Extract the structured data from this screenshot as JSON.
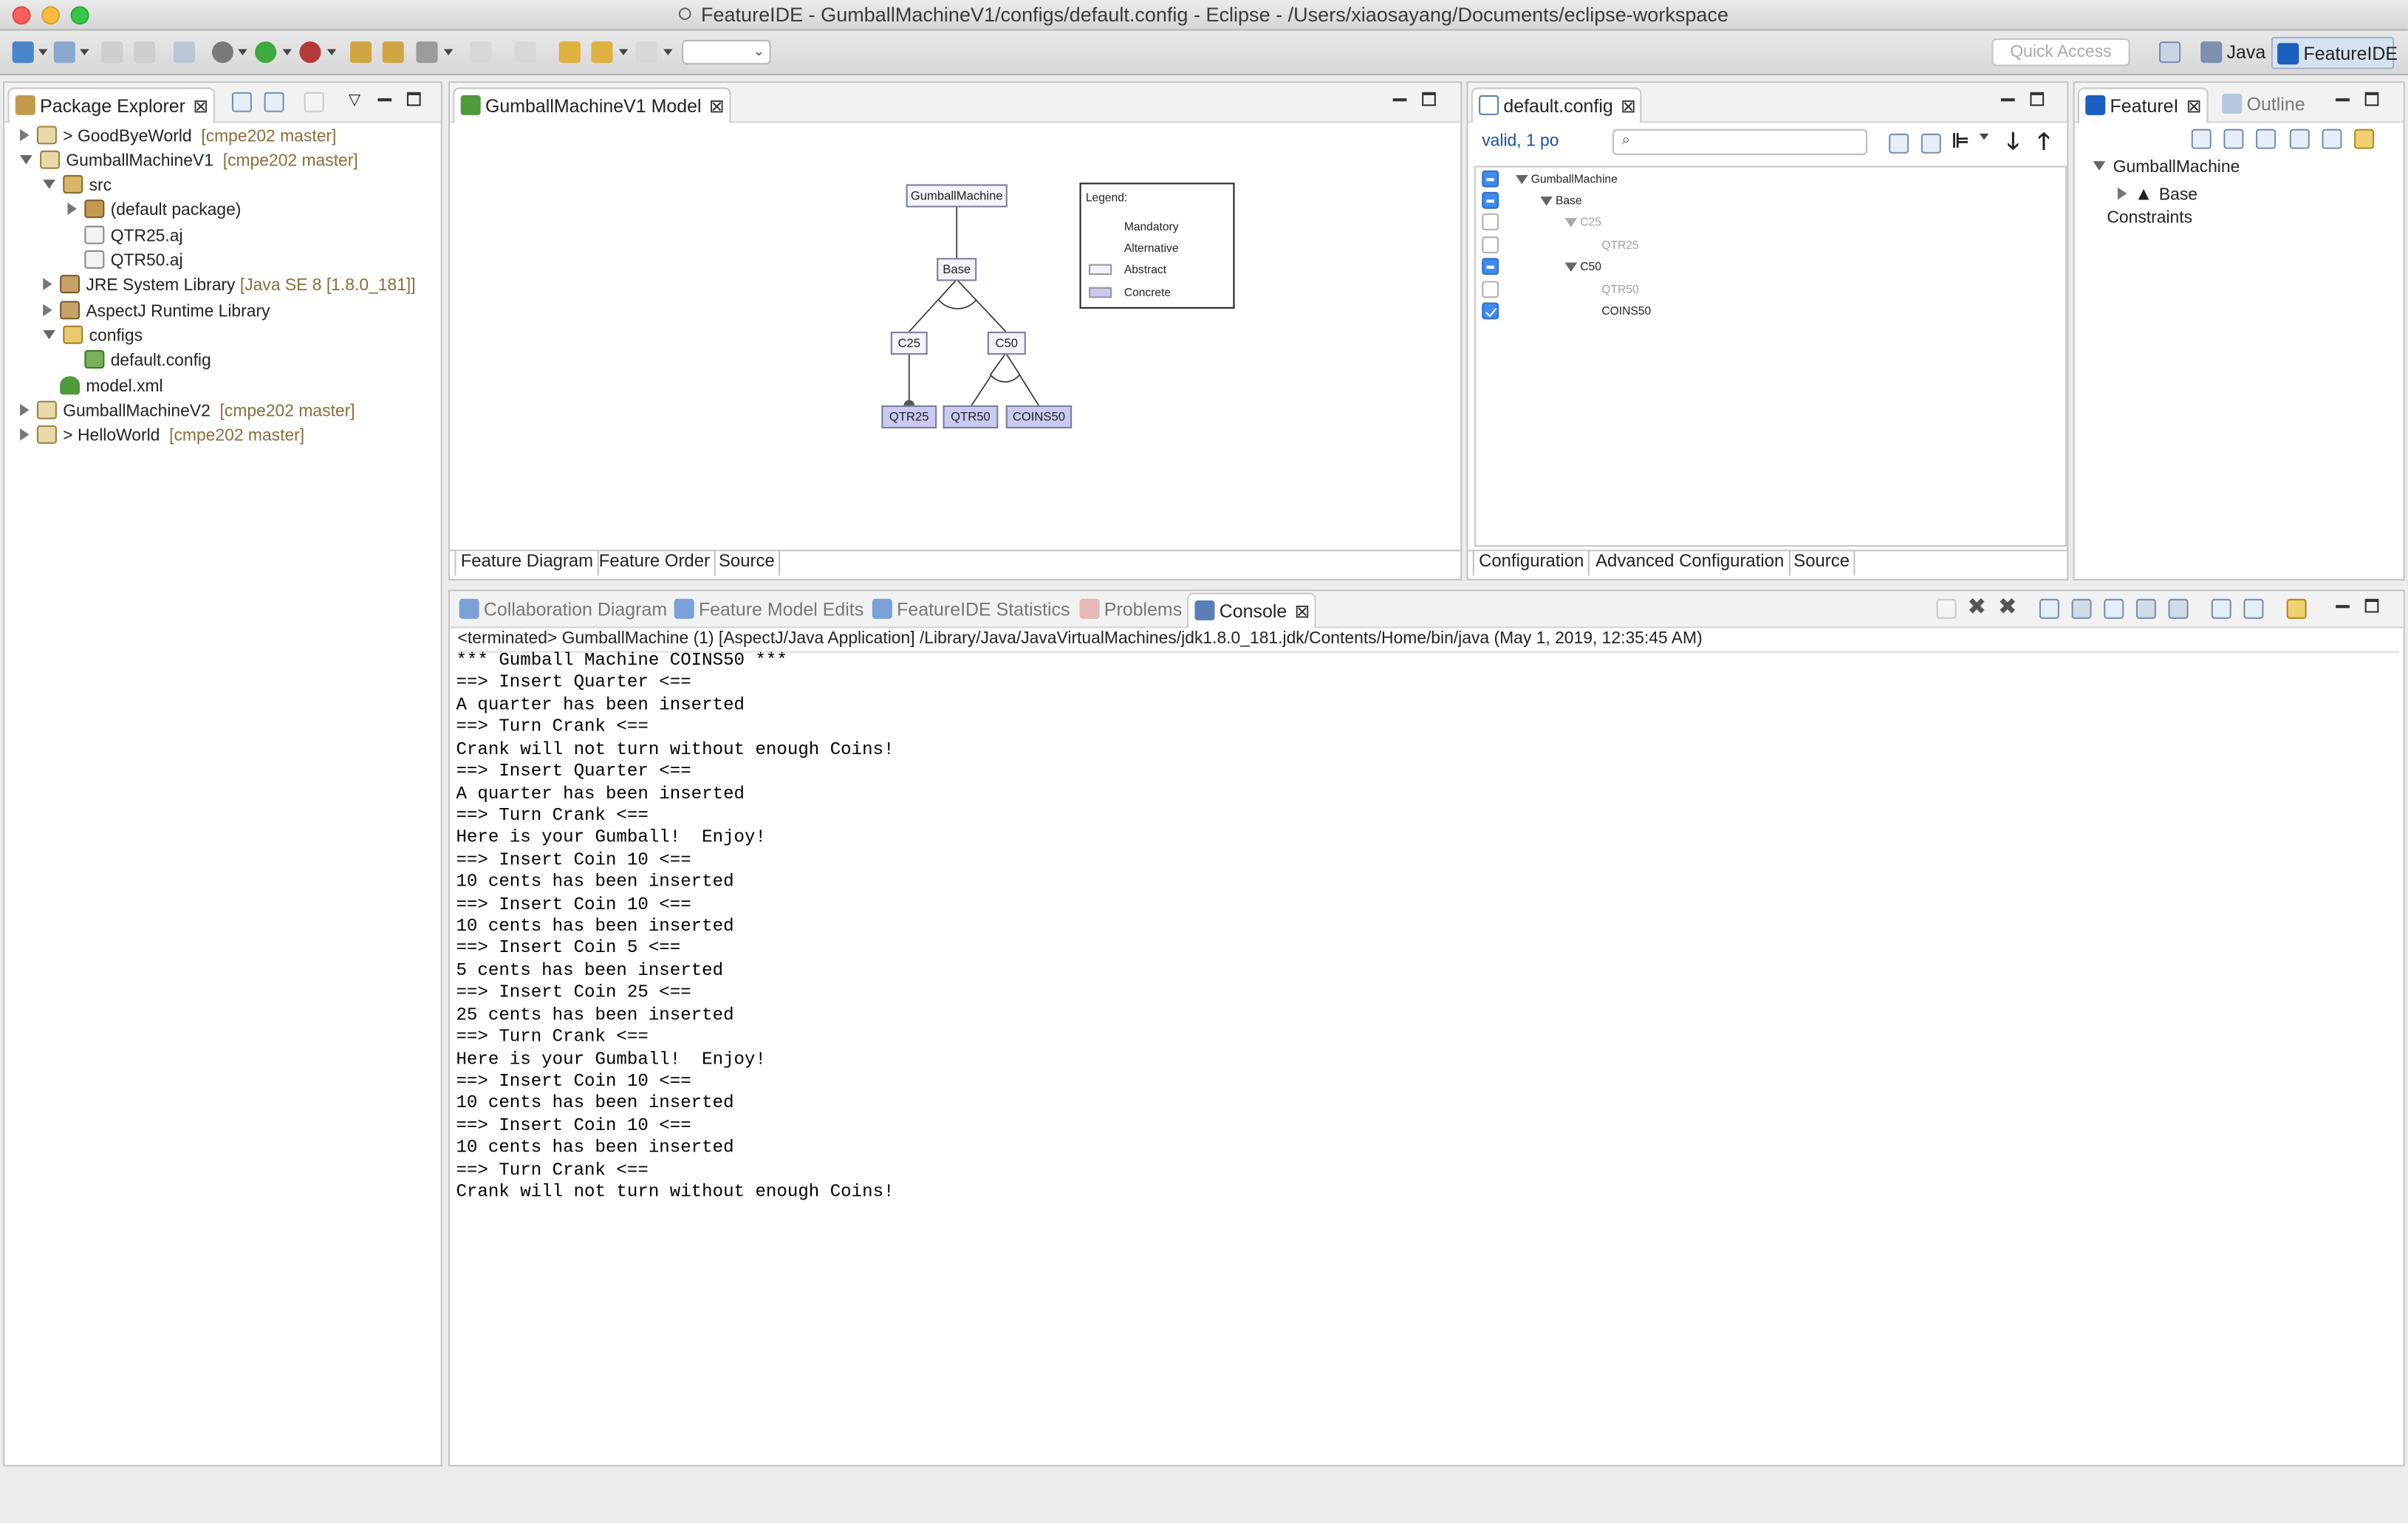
{
  "window": {
    "title": "FeatureIDE - GumballMachineV1/configs/default.config - Eclipse - /Users/xiaosayang/Documents/eclipse-workspace"
  },
  "toolbar": {
    "quick_access_placeholder": "Quick Access",
    "perspectives": [
      {
        "label": "Java",
        "icon": "java-perspective-icon"
      },
      {
        "label": "FeatureIDE",
        "icon": "featureide-perspective-icon",
        "active": true
      }
    ]
  },
  "package_explorer": {
    "tab_label": "Package Explorer",
    "tree": [
      {
        "prefix": "> ",
        "label": "GoodByeWorld",
        "tag": "[cmpe202 master]",
        "expanded": false,
        "icon": "project-icon"
      },
      {
        "prefix": "",
        "label": "GumballMachineV1",
        "tag": "[cmpe202 master]",
        "expanded": true,
        "icon": "project-icon"
      },
      {
        "label": "src",
        "expanded": true,
        "icon": "source-folder-icon"
      },
      {
        "label": "(default package)",
        "expanded": false,
        "icon": "package-icon"
      },
      {
        "label": "QTR25.aj",
        "icon": "aspect-file-icon"
      },
      {
        "label": "QTR50.aj",
        "icon": "aspect-file-icon"
      },
      {
        "label": "JRE System Library",
        "tag": "[Java SE 8 [1.8.0_181]]",
        "expanded": false,
        "icon": "library-icon"
      },
      {
        "label": "AspectJ Runtime Library",
        "expanded": false,
        "icon": "library-icon"
      },
      {
        "label": "configs",
        "expanded": true,
        "icon": "folder-icon"
      },
      {
        "label": "default.config",
        "icon": "config-file-icon"
      },
      {
        "label": "model.xml",
        "icon": "feature-model-icon"
      },
      {
        "prefix": "",
        "label": "GumballMachineV2",
        "tag": "[cmpe202 master]",
        "expanded": false,
        "icon": "project-icon"
      },
      {
        "prefix": "> ",
        "label": "HelloWorld",
        "tag": "[cmpe202 master]",
        "expanded": false,
        "icon": "project-icon"
      }
    ]
  },
  "model_editor": {
    "tab_label": "GumballMachineV1 Model",
    "features": {
      "root": "GumballMachine",
      "base": "Base",
      "c25": "C25",
      "c50": "C50",
      "qtr25": "QTR25",
      "qtr50": "QTR50",
      "coins50": "COINS50"
    },
    "legend": {
      "title": "Legend:",
      "mandatory": "Mandatory",
      "alternative": "Alternative",
      "abstract": "Abstract",
      "concrete": "Concrete"
    },
    "bottom_tabs": [
      "Feature Diagram",
      "Feature Order",
      "Source"
    ]
  },
  "config_editor": {
    "tab_label": "default.config",
    "status": "valid, 1 po",
    "search_value": "",
    "rows": [
      {
        "label": "GumballMachine",
        "state": "minus",
        "expanded": true,
        "grey": false
      },
      {
        "label": "Base",
        "state": "minus",
        "expanded": true,
        "grey": false
      },
      {
        "label": "C25",
        "state": "none",
        "expanded": true,
        "grey": true
      },
      {
        "label": "QTR25",
        "state": "none",
        "grey": true
      },
      {
        "label": "C50",
        "state": "minus",
        "expanded": true,
        "grey": false
      },
      {
        "label": "QTR50",
        "state": "none",
        "grey": true
      },
      {
        "label": "COINS50",
        "state": "check",
        "grey": false
      }
    ],
    "bottom_tabs": [
      "Configuration",
      "Advanced Configuration",
      "Source"
    ]
  },
  "outline_panel": {
    "tabs": [
      "FeatureI",
      "Outline"
    ],
    "tree": {
      "root": "GumballMachine",
      "child": "Base",
      "constraints": "Constraints"
    }
  },
  "bottom_panel": {
    "tabs": [
      "Collaboration Diagram",
      "Feature Model Edits",
      "FeatureIDE Statistics",
      "Problems",
      "Console"
    ],
    "active_tab": "Console",
    "console_header": "<terminated> GumballMachine (1) [AspectJ/Java Application] /Library/Java/JavaVirtualMachines/jdk1.8.0_181.jdk/Contents/Home/bin/java (May 1, 2019, 12:35:45 AM)",
    "console_lines": [
      "*** Gumball Machine COINS50 ***",
      "==> Insert Quarter <==",
      "A quarter has been inserted",
      "==> Turn Crank <==",
      "Crank will not turn without enough Coins!",
      "==> Insert Quarter <==",
      "A quarter has been inserted",
      "==> Turn Crank <==",
      "Here is your Gumball!  Enjoy!",
      "==> Insert Coin 10 <==",
      "10 cents has been inserted",
      "==> Insert Coin 10 <==",
      "10 cents has been inserted",
      "==> Insert Coin 5 <==",
      "5 cents has been inserted",
      "==> Insert Coin 25 <==",
      "25 cents has been inserted",
      "==> Turn Crank <==",
      "Here is your Gumball!  Enjoy!",
      "==> Insert Coin 10 <==",
      "10 cents has been inserted",
      "==> Insert Coin 10 <==",
      "10 cents has been inserted",
      "==> Turn Crank <==",
      "Crank will not turn without enough Coins!"
    ]
  },
  "colors": {
    "concrete_feature": "#c9c9f2",
    "abstract_feature": "#f3f3fb",
    "git_tag": "#8a6d3b",
    "checkbox_blue": "#3d8bf0"
  }
}
